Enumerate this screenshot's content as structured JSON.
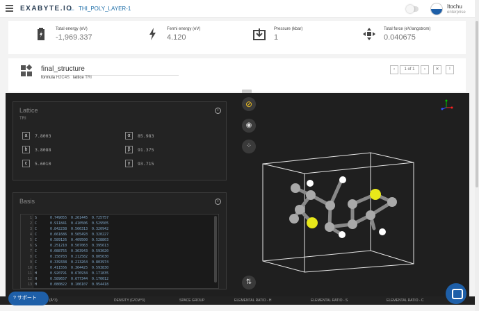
{
  "header": {
    "logo": "EXABYTE.IO",
    "job_title": "THI_POLY_LAYER-1",
    "user_name": "Itochu",
    "user_org": "enterprise"
  },
  "properties": [
    {
      "label": "Total energy (eV)",
      "value": "-1,969.337",
      "icon": "battery-icon"
    },
    {
      "label": "Fermi energy (eV)",
      "value": "4.120",
      "icon": "lightning-icon"
    },
    {
      "label": "Pressure (kbar)",
      "value": "1",
      "icon": "pressure-icon"
    },
    {
      "label": "Total force (eV/angstrom)",
      "value": "0.040675",
      "icon": "force-icon"
    }
  ],
  "structure": {
    "name": "final_structure",
    "formula_label": "formula",
    "formula": "H2C4S",
    "lattice_label": "lattice",
    "lattice": "TRI",
    "pager": "1 of 1"
  },
  "lattice_panel": {
    "title": "Lattice",
    "type": "TRI",
    "params": [
      {
        "sym": "a",
        "value": "7.8003"
      },
      {
        "sym": "b",
        "value": "3.8088"
      },
      {
        "sym": "c",
        "value": "5.6010"
      },
      {
        "sym": "α",
        "value": "85.983"
      },
      {
        "sym": "β",
        "value": "91.375"
      },
      {
        "sym": "γ",
        "value": "93.715"
      }
    ]
  },
  "basis_panel": {
    "title": "Basis",
    "rows": [
      {
        "n": "1",
        "el": "S",
        "x": "0.749055",
        "y": "0.261445",
        "z": "0.725757"
      },
      {
        "n": "2",
        "el": "C",
        "x": "0.911841",
        "y": "0.410506",
        "z": "0.529505"
      },
      {
        "n": "3",
        "el": "C",
        "x": "0.842238",
        "y": "0.566313",
        "z": "0.320942"
      },
      {
        "n": "4",
        "el": "C",
        "x": "0.661686",
        "y": "0.565493",
        "z": "0.320227"
      },
      {
        "n": "5",
        "el": "C",
        "x": "0.589126",
        "y": "0.409500",
        "z": "0.528803"
      },
      {
        "n": "6",
        "el": "S",
        "x": "0.251210",
        "y": "0.507063",
        "z": "0.395613"
      },
      {
        "n": "7",
        "el": "C",
        "x": "0.088755",
        "y": "0.363943",
        "z": "0.593020"
      },
      {
        "n": "8",
        "el": "C",
        "x": "0.158783",
        "y": "0.212582",
        "z": "0.805630"
      },
      {
        "n": "9",
        "el": "C",
        "x": "0.339338",
        "y": "0.213264",
        "z": "0.803974"
      },
      {
        "n": "10",
        "el": "C",
        "x": "0.411556",
        "y": "0.364425",
        "z": "0.593830"
      },
      {
        "n": "11",
        "el": "H",
        "x": "0.920791",
        "y": "0.676934",
        "z": "0.171835"
      },
      {
        "n": "12",
        "el": "H",
        "x": "0.589657",
        "y": "0.677344",
        "z": "0.170012"
      },
      {
        "n": "13",
        "el": "H",
        "x": "0.080822",
        "y": "0.106107",
        "z": "0.954418"
      }
    ]
  },
  "footer_columns": [
    "ME (Å^3)",
    "DENSITY (G/CM^3)",
    "SPACE GROUP",
    "ELEMENTAL RATIO - H",
    "ELEMENTAL RATIO - S",
    "ELEMENTAL RATIO - C"
  ],
  "support_label": "サポート",
  "colors": {
    "accent": "#1e5fa8",
    "sulfur": "#e8e81a",
    "carbon": "#a9a9a9",
    "hydrogen": "#ffffff"
  }
}
